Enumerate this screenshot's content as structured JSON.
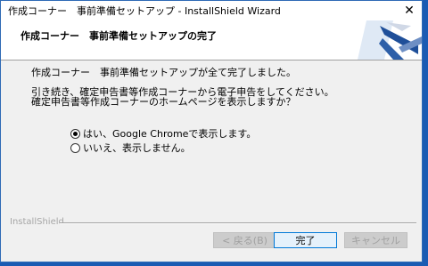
{
  "window": {
    "title": "作成コーナー　事前準備セットアップ - InstallShield Wizard",
    "close_glyph": "✕"
  },
  "header": {
    "title": "作成コーナー　事前準備セットアップの完了"
  },
  "content": {
    "line1": "作成コーナー　事前準備セットアップが全て完了しました。",
    "line2": "引き続き、確定申告書等作成コーナーから電子申告をしてください。",
    "line3": "確定申告書等作成コーナーのホームページを表示しますか？",
    "options": [
      {
        "label": "はい、Google Chromeで表示します。",
        "selected": true
      },
      {
        "label": "いいえ、表示しません。",
        "selected": false
      }
    ]
  },
  "footer": {
    "brand": "InstallShield",
    "back_label": "< 戻る(B)",
    "finish_label": "完了",
    "cancel_label": "キャンセル"
  },
  "colors": {
    "desktop": "#1a5bb3",
    "accent_blue": "#0078d7"
  }
}
